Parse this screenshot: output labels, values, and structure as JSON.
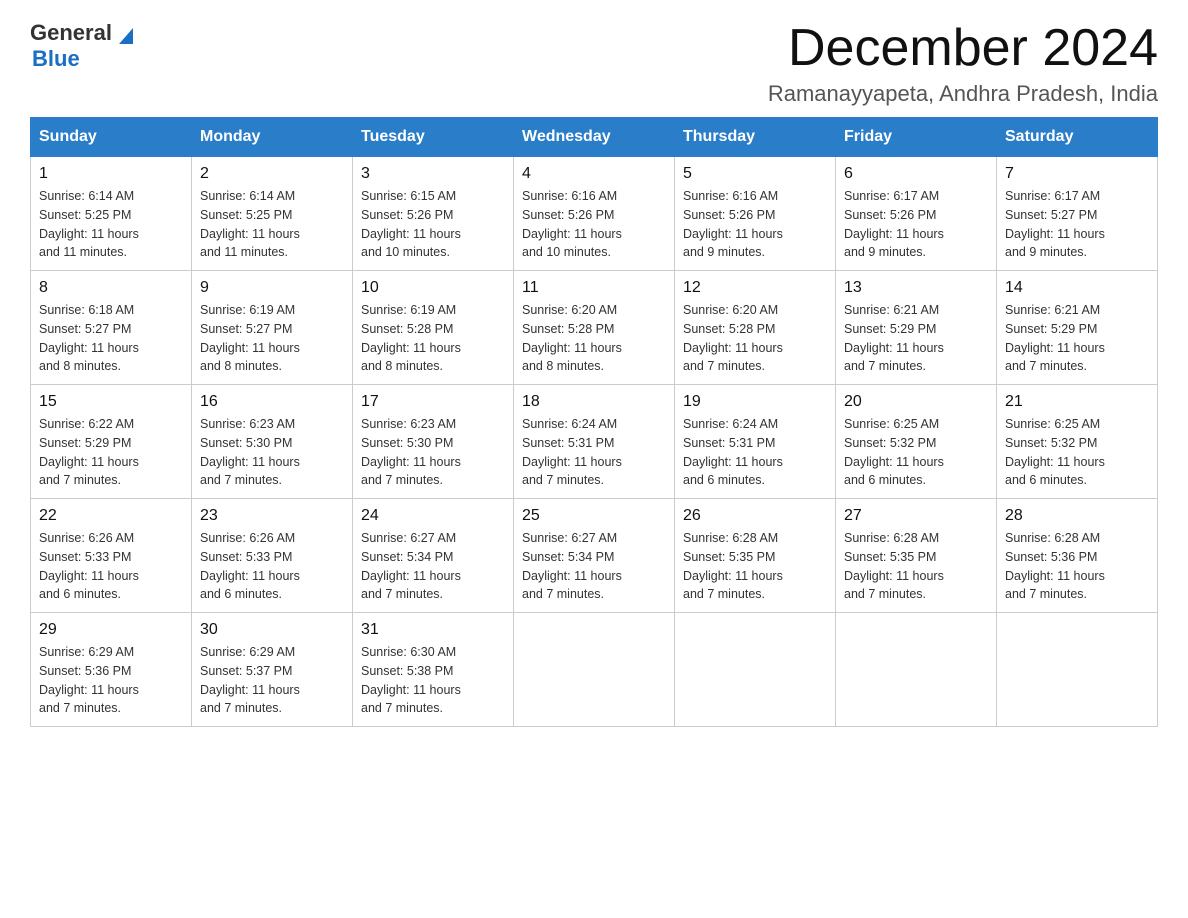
{
  "header": {
    "logo_general": "General",
    "logo_blue": "Blue",
    "month_title": "December 2024",
    "location": "Ramanayyapeta, Andhra Pradesh, India"
  },
  "days_of_week": [
    "Sunday",
    "Monday",
    "Tuesday",
    "Wednesday",
    "Thursday",
    "Friday",
    "Saturday"
  ],
  "weeks": [
    [
      {
        "day": "1",
        "sunrise": "6:14 AM",
        "sunset": "5:25 PM",
        "daylight": "11 hours and 11 minutes."
      },
      {
        "day": "2",
        "sunrise": "6:14 AM",
        "sunset": "5:25 PM",
        "daylight": "11 hours and 11 minutes."
      },
      {
        "day": "3",
        "sunrise": "6:15 AM",
        "sunset": "5:26 PM",
        "daylight": "11 hours and 10 minutes."
      },
      {
        "day": "4",
        "sunrise": "6:16 AM",
        "sunset": "5:26 PM",
        "daylight": "11 hours and 10 minutes."
      },
      {
        "day": "5",
        "sunrise": "6:16 AM",
        "sunset": "5:26 PM",
        "daylight": "11 hours and 9 minutes."
      },
      {
        "day": "6",
        "sunrise": "6:17 AM",
        "sunset": "5:26 PM",
        "daylight": "11 hours and 9 minutes."
      },
      {
        "day": "7",
        "sunrise": "6:17 AM",
        "sunset": "5:27 PM",
        "daylight": "11 hours and 9 minutes."
      }
    ],
    [
      {
        "day": "8",
        "sunrise": "6:18 AM",
        "sunset": "5:27 PM",
        "daylight": "11 hours and 8 minutes."
      },
      {
        "day": "9",
        "sunrise": "6:19 AM",
        "sunset": "5:27 PM",
        "daylight": "11 hours and 8 minutes."
      },
      {
        "day": "10",
        "sunrise": "6:19 AM",
        "sunset": "5:28 PM",
        "daylight": "11 hours and 8 minutes."
      },
      {
        "day": "11",
        "sunrise": "6:20 AM",
        "sunset": "5:28 PM",
        "daylight": "11 hours and 8 minutes."
      },
      {
        "day": "12",
        "sunrise": "6:20 AM",
        "sunset": "5:28 PM",
        "daylight": "11 hours and 7 minutes."
      },
      {
        "day": "13",
        "sunrise": "6:21 AM",
        "sunset": "5:29 PM",
        "daylight": "11 hours and 7 minutes."
      },
      {
        "day": "14",
        "sunrise": "6:21 AM",
        "sunset": "5:29 PM",
        "daylight": "11 hours and 7 minutes."
      }
    ],
    [
      {
        "day": "15",
        "sunrise": "6:22 AM",
        "sunset": "5:29 PM",
        "daylight": "11 hours and 7 minutes."
      },
      {
        "day": "16",
        "sunrise": "6:23 AM",
        "sunset": "5:30 PM",
        "daylight": "11 hours and 7 minutes."
      },
      {
        "day": "17",
        "sunrise": "6:23 AM",
        "sunset": "5:30 PM",
        "daylight": "11 hours and 7 minutes."
      },
      {
        "day": "18",
        "sunrise": "6:24 AM",
        "sunset": "5:31 PM",
        "daylight": "11 hours and 7 minutes."
      },
      {
        "day": "19",
        "sunrise": "6:24 AM",
        "sunset": "5:31 PM",
        "daylight": "11 hours and 6 minutes."
      },
      {
        "day": "20",
        "sunrise": "6:25 AM",
        "sunset": "5:32 PM",
        "daylight": "11 hours and 6 minutes."
      },
      {
        "day": "21",
        "sunrise": "6:25 AM",
        "sunset": "5:32 PM",
        "daylight": "11 hours and 6 minutes."
      }
    ],
    [
      {
        "day": "22",
        "sunrise": "6:26 AM",
        "sunset": "5:33 PM",
        "daylight": "11 hours and 6 minutes."
      },
      {
        "day": "23",
        "sunrise": "6:26 AM",
        "sunset": "5:33 PM",
        "daylight": "11 hours and 6 minutes."
      },
      {
        "day": "24",
        "sunrise": "6:27 AM",
        "sunset": "5:34 PM",
        "daylight": "11 hours and 7 minutes."
      },
      {
        "day": "25",
        "sunrise": "6:27 AM",
        "sunset": "5:34 PM",
        "daylight": "11 hours and 7 minutes."
      },
      {
        "day": "26",
        "sunrise": "6:28 AM",
        "sunset": "5:35 PM",
        "daylight": "11 hours and 7 minutes."
      },
      {
        "day": "27",
        "sunrise": "6:28 AM",
        "sunset": "5:35 PM",
        "daylight": "11 hours and 7 minutes."
      },
      {
        "day": "28",
        "sunrise": "6:28 AM",
        "sunset": "5:36 PM",
        "daylight": "11 hours and 7 minutes."
      }
    ],
    [
      {
        "day": "29",
        "sunrise": "6:29 AM",
        "sunset": "5:36 PM",
        "daylight": "11 hours and 7 minutes."
      },
      {
        "day": "30",
        "sunrise": "6:29 AM",
        "sunset": "5:37 PM",
        "daylight": "11 hours and 7 minutes."
      },
      {
        "day": "31",
        "sunrise": "6:30 AM",
        "sunset": "5:38 PM",
        "daylight": "11 hours and 7 minutes."
      },
      null,
      null,
      null,
      null
    ]
  ],
  "labels": {
    "sunrise": "Sunrise:",
    "sunset": "Sunset:",
    "daylight": "Daylight:"
  }
}
